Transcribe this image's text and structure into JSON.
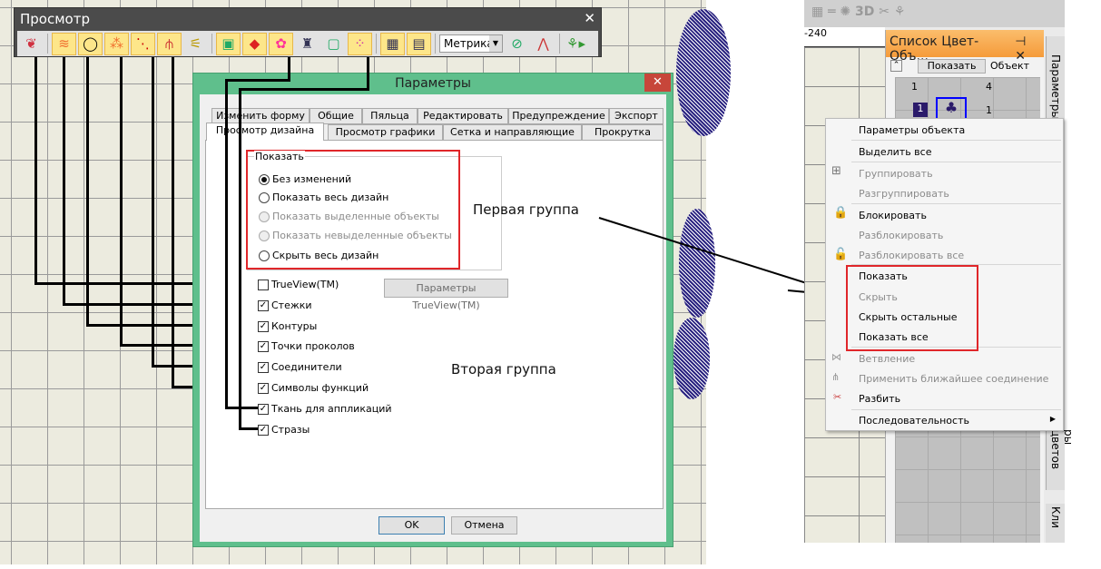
{
  "toolbar": {
    "title": "Просмотр",
    "close": "✕",
    "units_select": "Метрика",
    "icons": [
      "stitches-leaf-icon",
      "stitches-icon",
      "outlines-icon",
      "needle-points-icon",
      "connectors-icon",
      "function-symbols-icon",
      "fish-icon",
      "background-icon",
      "shapes-icon",
      "applique-fabric-icon",
      "garment-icon",
      "hoop-icon",
      "rhinestones-icon",
      "grid-icon",
      "guides-icon"
    ]
  },
  "dialog": {
    "title": "Параметры",
    "close": "✕",
    "tabs_row1": [
      "Изменить форму",
      "Общие",
      "Пяльца",
      "Редактировать",
      "Предупреждение",
      "Экспорт"
    ],
    "tabs_row2": [
      "Просмотр дизайна",
      "Просмотр графики",
      "Сетка и направляющие",
      "Прокрутка"
    ],
    "group_title": "Показать",
    "radios": [
      {
        "label": "Без изменений",
        "selected": true,
        "disabled": false
      },
      {
        "label": "Показать весь дизайн",
        "selected": false,
        "disabled": false
      },
      {
        "label": "Показать выделенные объекты",
        "selected": false,
        "disabled": true
      },
      {
        "label": "Показать невыделенные объекты",
        "selected": false,
        "disabled": true
      },
      {
        "label": "Скрыть весь дизайн",
        "selected": false,
        "disabled": false
      }
    ],
    "checkboxes": [
      {
        "label": "TrueView(TM)",
        "checked": false
      },
      {
        "label": "Стежки",
        "checked": true
      },
      {
        "label": "Контуры",
        "checked": true
      },
      {
        "label": "Точки проколов",
        "checked": true
      },
      {
        "label": "Соединители",
        "checked": true
      },
      {
        "label": "Символы функций",
        "checked": true
      },
      {
        "label": "Ткань для аппликаций",
        "checked": true
      },
      {
        "label": "Стразы",
        "checked": true
      }
    ],
    "trueview_button": "Параметры TrueView(TM)",
    "ok": "OK",
    "cancel": "Отмена"
  },
  "annotations": {
    "first_group": "Первая группа",
    "second_group": "Вторая группа"
  },
  "right": {
    "ruler_label": "-240",
    "panel_title": "Список Цвет-Объ...",
    "panel_show_button": "Показать",
    "panel_col_label": "Объект",
    "grid_headers": [
      "1",
      "4"
    ],
    "row_number": "1",
    "row_value": "1",
    "side_tab1": "Параметры",
    "side_tab2": "ры цветов",
    "side_tab3": "Кли",
    "menu": [
      {
        "label": "Параметры объекта",
        "disabled": false
      },
      {
        "label": "Выделить все",
        "disabled": false
      },
      {
        "label": "Группировать",
        "disabled": true
      },
      {
        "label": "Разгруппировать",
        "disabled": true
      },
      {
        "label": "Блокировать",
        "disabled": false
      },
      {
        "label": "Разблокировать",
        "disabled": true
      },
      {
        "label": "Разблокировать все",
        "disabled": true
      },
      {
        "label": "Показать",
        "disabled": false
      },
      {
        "label": "Скрыть",
        "disabled": true
      },
      {
        "label": "Скрыть остальные",
        "disabled": false
      },
      {
        "label": "Показать все",
        "disabled": false
      },
      {
        "label": "Ветвление",
        "disabled": true
      },
      {
        "label": "Применить ближайшее соединение",
        "disabled": true
      },
      {
        "label": "Разбить",
        "disabled": false
      },
      {
        "label": "Последовательность",
        "disabled": false,
        "submenu": true
      }
    ]
  },
  "colors": {
    "dialog_border": "#5fbf8c",
    "highlight": "#e0262a",
    "panel_header": "#f7a54a"
  }
}
